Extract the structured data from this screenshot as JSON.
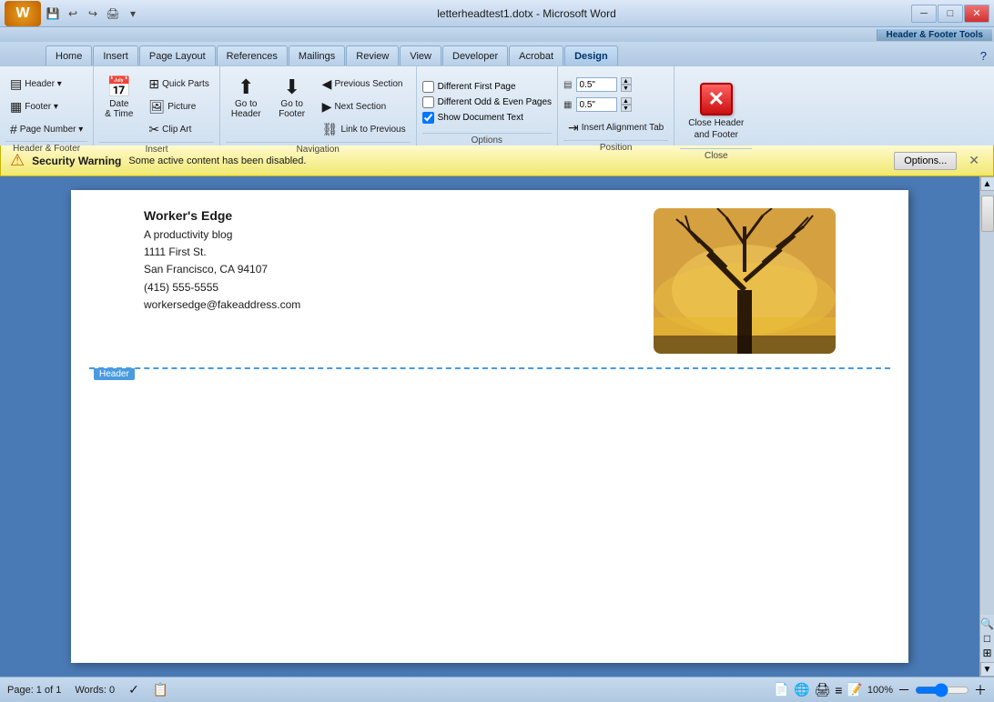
{
  "titlebar": {
    "title": "letterheadtest1.dotx - Microsoft Word",
    "tools_label": "Header & Footer Tools",
    "minimize": "─",
    "maximize": "□",
    "close": "✕"
  },
  "tabs": [
    {
      "label": "Home",
      "shortcut": "H"
    },
    {
      "label": "Insert",
      "shortcut": "N"
    },
    {
      "label": "Page Layout",
      "shortcut": "P"
    },
    {
      "label": "References",
      "shortcut": "S"
    },
    {
      "label": "Mailings",
      "shortcut": "M"
    },
    {
      "label": "Review",
      "shortcut": "R"
    },
    {
      "label": "View",
      "shortcut": "W"
    },
    {
      "label": "Developer",
      "shortcut": "L"
    },
    {
      "label": "Acrobat",
      "shortcut": "B"
    },
    {
      "label": "Design",
      "shortcut": "JH",
      "active": true
    }
  ],
  "ribbon": {
    "groups": [
      {
        "name": "Header & Footer",
        "items": [
          {
            "label": "Header ▾",
            "icon": "▤"
          },
          {
            "label": "Footer ▾",
            "icon": "▦"
          },
          {
            "label": "Page Number ▾",
            "icon": "#"
          }
        ]
      },
      {
        "name": "Insert",
        "items": [
          {
            "label": "Date\n& Time",
            "icon": "📅"
          },
          {
            "label": "Quick Parts",
            "icon": "⊞"
          },
          {
            "label": "Picture",
            "icon": "🖼"
          },
          {
            "label": "Clip Art",
            "icon": "✂"
          }
        ]
      },
      {
        "name": "Navigation",
        "items": [
          {
            "label": "Go to\nHeader",
            "icon": "↑"
          },
          {
            "label": "Go to\nFooter",
            "icon": "↓"
          },
          {
            "label": "Previous Section",
            "icon": "◀"
          },
          {
            "label": "Next Section",
            "icon": "▶"
          },
          {
            "label": "Link to Previous",
            "icon": "⛓"
          }
        ]
      },
      {
        "name": "Options",
        "items": [
          {
            "label": "Different First Page",
            "checked": false
          },
          {
            "label": "Different Odd & Even Pages",
            "checked": false
          },
          {
            "label": "Show Document Text",
            "checked": true
          }
        ]
      },
      {
        "name": "Position",
        "pos1_value": "0.5\"",
        "pos2_value": "0.5\""
      }
    ],
    "close_button": {
      "label": "Close Header\nand Footer",
      "icon": "✕"
    }
  },
  "security_bar": {
    "title": "Security Warning",
    "message": "Some active content has been disabled.",
    "button": "Options...",
    "icon": "⚠"
  },
  "document": {
    "company": "Worker's Edge",
    "tagline": "A productivity blog",
    "address1": "1111 First St.",
    "address2": "San Francisco, CA 94107",
    "phone": "(415) 555-5555",
    "email": "workersedge@fakeaddress.com",
    "header_label": "Header"
  },
  "statusbar": {
    "page": "Page: 1 of 1",
    "words": "Words: 0",
    "zoom": "100%"
  }
}
